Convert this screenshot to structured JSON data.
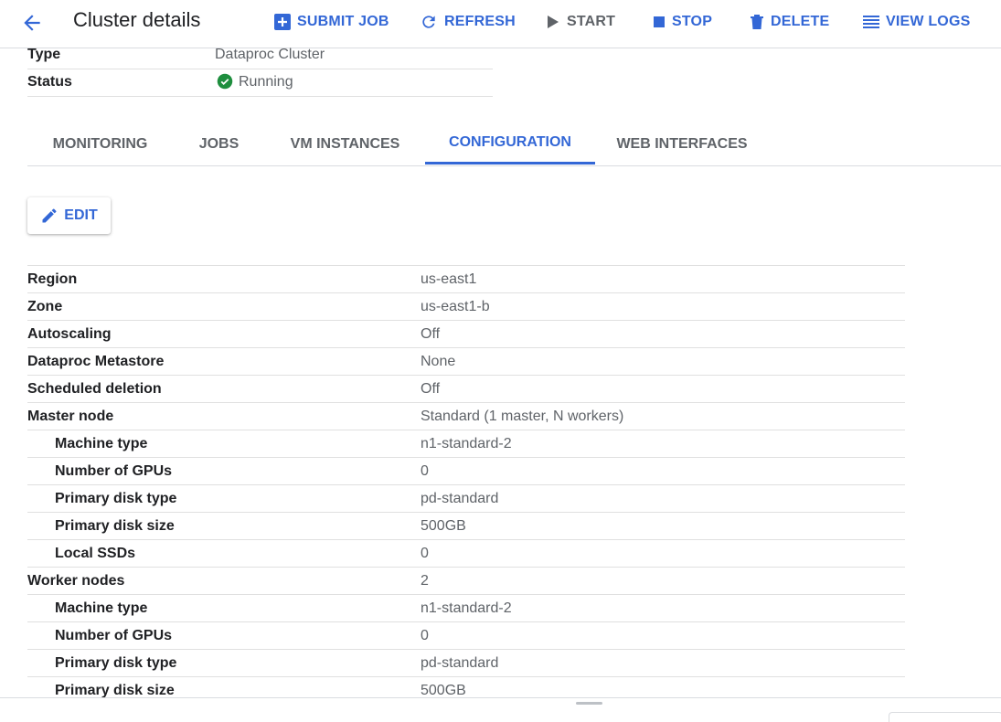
{
  "header": {
    "title": "Cluster details",
    "actions": {
      "submit_job": "SUBMIT JOB",
      "refresh": "REFRESH",
      "start": "START",
      "stop": "STOP",
      "delete": "DELETE",
      "view_logs": "VIEW LOGS"
    }
  },
  "summary": {
    "type_label": "Type",
    "type_value": "Dataproc Cluster",
    "status_label": "Status",
    "status_value": "Running"
  },
  "tabs": [
    "MONITORING",
    "JOBS",
    "VM INSTANCES",
    "CONFIGURATION",
    "WEB INTERFACES"
  ],
  "active_tab": "CONFIGURATION",
  "edit_label": "EDIT",
  "config": {
    "rows": [
      {
        "label": "Region",
        "value": "us-east1"
      },
      {
        "label": "Zone",
        "value": "us-east1-b"
      },
      {
        "label": "Autoscaling",
        "value": "Off"
      },
      {
        "label": "Dataproc Metastore",
        "value": "None"
      },
      {
        "label": "Scheduled deletion",
        "value": "Off"
      },
      {
        "label": "Master node",
        "value": "Standard (1 master, N workers)"
      },
      {
        "label": "Machine type",
        "value": "n1-standard-2"
      },
      {
        "label": "Number of GPUs",
        "value": "0"
      },
      {
        "label": "Primary disk type",
        "value": "pd-standard"
      },
      {
        "label": "Primary disk size",
        "value": "500GB"
      },
      {
        "label": "Local SSDs",
        "value": "0"
      },
      {
        "label": "Worker nodes",
        "value": "2"
      },
      {
        "label": "Machine type",
        "value": "n1-standard-2"
      },
      {
        "label": "Number of GPUs",
        "value": "0"
      },
      {
        "label": "Primary disk type",
        "value": "pd-standard"
      },
      {
        "label": "Primary disk size",
        "value": "500GB"
      }
    ]
  },
  "colors": {
    "accent": "#3367d6",
    "status_ok": "#1e8e3e",
    "muted_text": "#5f6368"
  }
}
